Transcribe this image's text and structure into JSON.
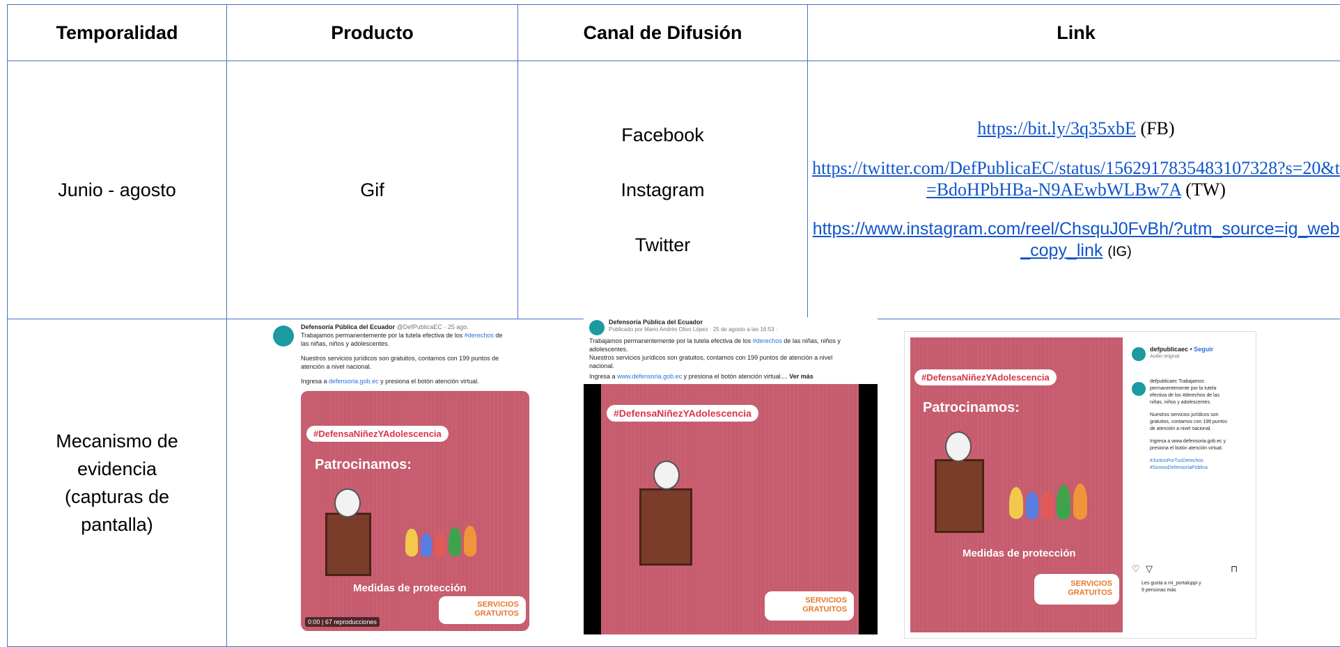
{
  "headers": {
    "temporalidad": "Temporalidad",
    "producto": "Producto",
    "canal": "Canal de Difusión",
    "link": "Link"
  },
  "row1": {
    "temporalidad": "Junio - agosto",
    "producto": "Gif",
    "canales": [
      "Facebook",
      "Instagram",
      "Twitter"
    ],
    "links": [
      {
        "url": "https://bit.ly/3q35xbE",
        "tag": "(FB)"
      },
      {
        "url": "https://twitter.com/DefPublicaEC/status/1562917835483107328?s=20&t=BdoHPbHBa-N9AEwbWLBw7A",
        "tag": "(TW)"
      },
      {
        "url": "https://www.instagram.com/reel/ChsquJ0FvBh/?utm_source=ig_web_copy_link",
        "tag": "(IG)"
      }
    ]
  },
  "row2": {
    "label": "Mecanismo de evidencia (capturas de pantalla)"
  },
  "shot_twitter": {
    "account": "Defensoría Pública del Ecuador",
    "handle": "@DefPublicaEC · 25 ago.",
    "line1a": "Trabajamos permanentemente por la tutela efectiva de los ",
    "line1b": "#derechos",
    "line1c": " de",
    "line2": "las niñas, niños y adolescentes.",
    "line3": "Nuestros servicios jurídicos son gratuitos, contamos con 199 puntos de",
    "line4": "atención a nivel nacional.",
    "line5a": "Ingresa a ",
    "line5b": "defensoria.gob.ec",
    "line5c": " y presiona el botón atención virtual.",
    "hashtag": "#DefensaNiñezYAdolescencia",
    "patro": "Patrocinamos:",
    "medidas": "Medidas de protección",
    "servicios": "SERVICIOS",
    "gratuitos": "GRATUITOS",
    "plays": "0:00 | 67 reproducciones"
  },
  "shot_facebook": {
    "account": "Defensoría Pública del Ecuador",
    "published": "Publicado por Mario Andrés Olivo López · 25 de agosto a las 16:53 ·",
    "line1a": "Trabajamos permanentemente por la tutela efectiva de los ",
    "line1b": "#derechos",
    "line1c": " de las niñas, niños y",
    "line2": "adolescentes.",
    "line3": "Nuestros servicios jurídicos son gratuitos, contamos con 199 puntos de atención a nivel",
    "line4": "nacional.",
    "line5a": "Ingresa a ",
    "line5b": "www.defensoria.gob.ec",
    "line5c": " y presiona el botón atención virtual.... ",
    "vermas": "Ver más",
    "hashtag": "#DefensaNiñezYAdolescencia",
    "servicios": "SERVICIOS",
    "gratuitos": "GRATUITOS"
  },
  "shot_instagram": {
    "account": "defpublicaec",
    "follow": "Seguir",
    "audio": "Audio original",
    "cap1": "defpublicaec Trabajamos",
    "cap2": "permanentemente por la tutela",
    "cap3": "efectiva de los #derechos de las",
    "cap4": "niñas, niños y adolescentes.",
    "cap5": "Nuestros servicios jurídicos son",
    "cap6": "gratuitos, contamos con 199 puntos",
    "cap7": "de atención a nivel nacional.",
    "cap8": "Ingresa a www.defensoria.gob.ec y",
    "cap9": "presiona el botón atención virtual.",
    "cap10": "#JuntosPorTusDerechos",
    "cap11": "#SomosDefensoríaPública",
    "likes1": "Les gusta a mi_portaluppi y",
    "likes2": "9 personas más",
    "hashtag": "#DefensaNiñezYAdolescencia",
    "patro": "Patrocinamos:",
    "medidas": "Medidas de protección",
    "servicios": "SERVICIOS",
    "gratuitos": "GRATUITOS"
  }
}
